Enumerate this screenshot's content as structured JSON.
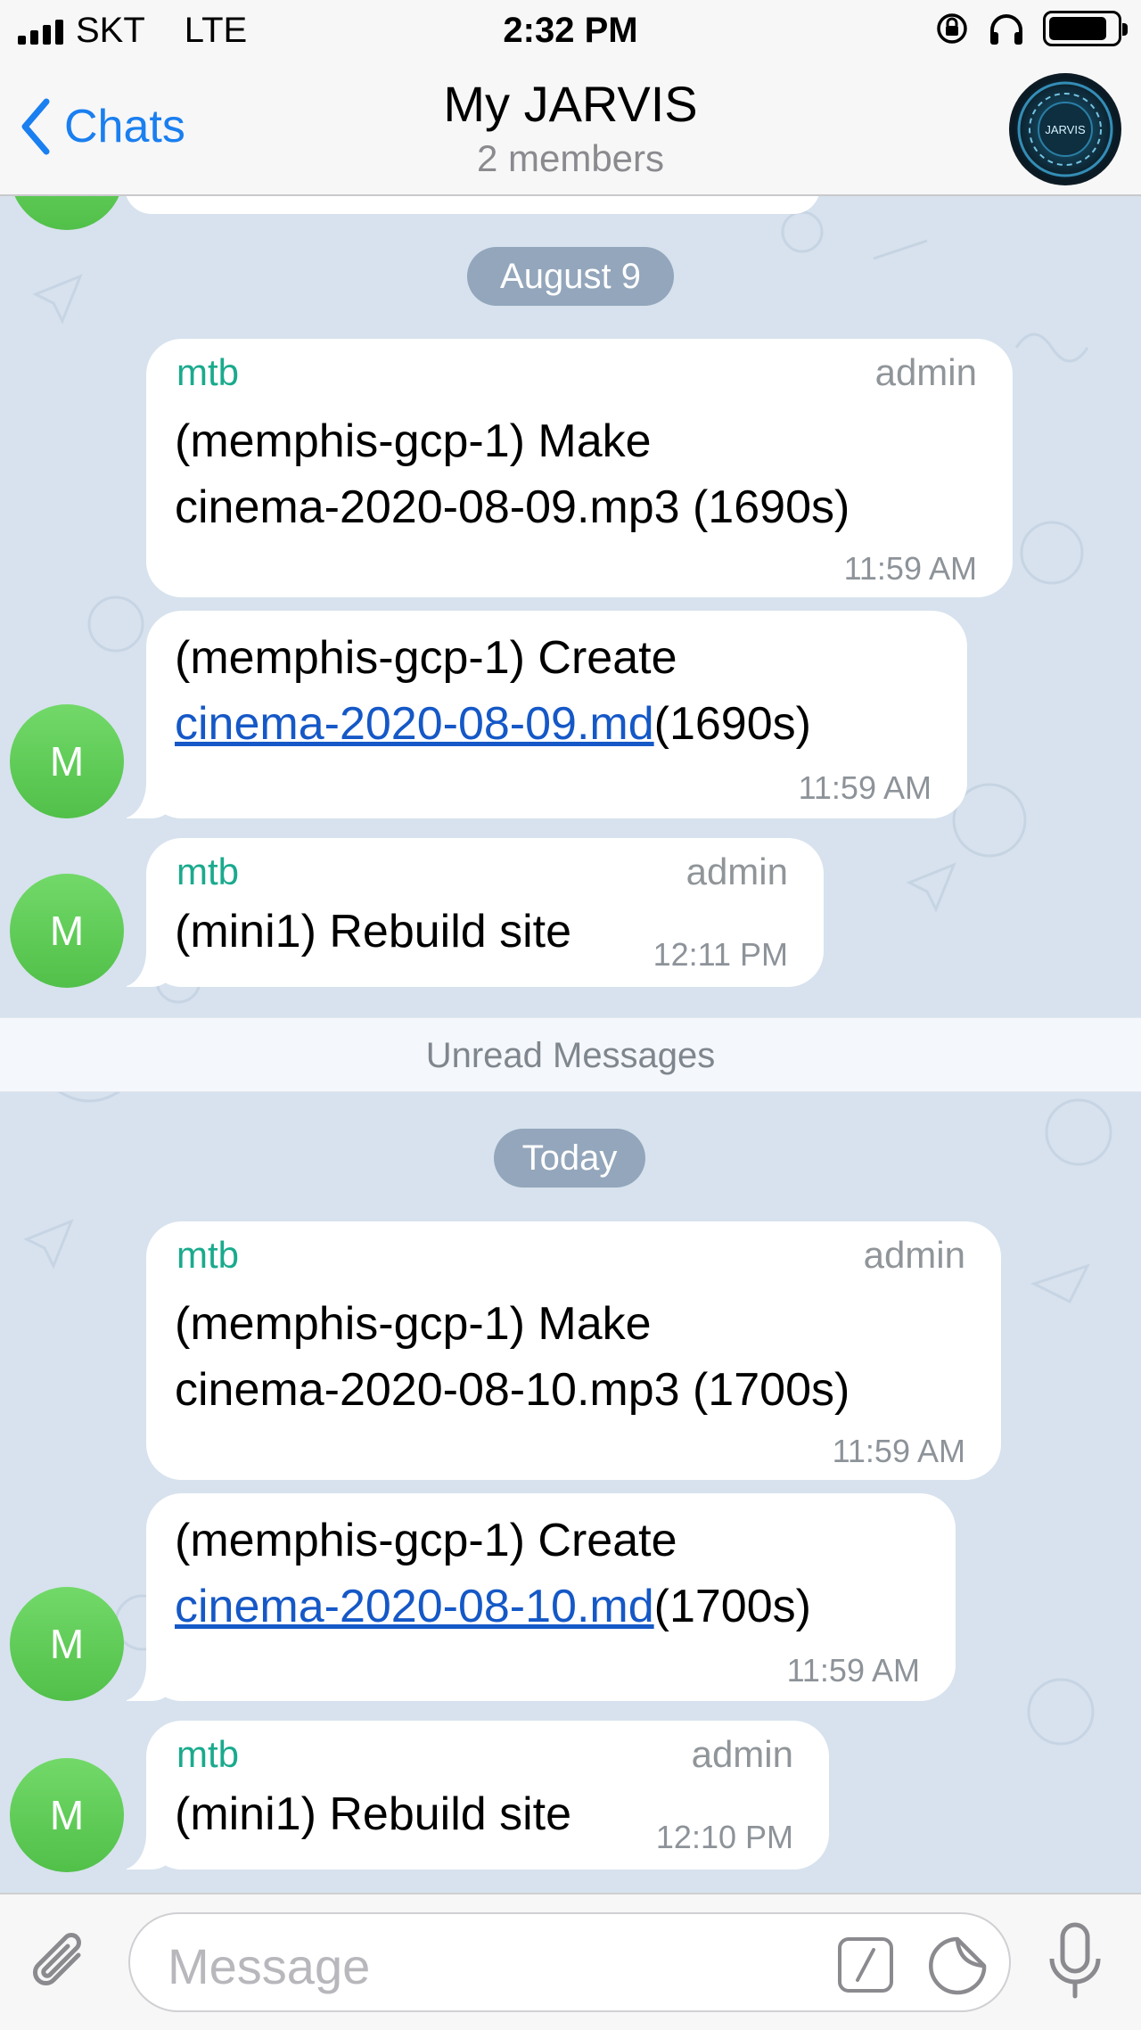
{
  "status_bar": {
    "carrier": "SKT",
    "network": "LTE",
    "time": "2:32 PM",
    "battery_level": 0.86
  },
  "header": {
    "back_label": "Chats",
    "title": "My JARVIS",
    "subtitle": "2 members",
    "avatar_text": "JARVIS"
  },
  "dates": {
    "first": "August 9",
    "second": "Today"
  },
  "unread_label": "Unread Messages",
  "messages": [
    {
      "sender": "mtb",
      "role": "admin",
      "line1": "(memphis-gcp-1) Make",
      "line2": "cinema-2020-08-09.mp3 (1690s)",
      "time": "11:59 AM"
    },
    {
      "line1": "(memphis-gcp-1) Create",
      "link": "cinema-2020-08-09.md",
      "suffix": "(1690s)",
      "time": "11:59 AM",
      "avatar": "M"
    },
    {
      "sender": "mtb",
      "role": "admin",
      "text": "(mini1) Rebuild site",
      "time": "12:11 PM",
      "avatar": "M"
    },
    {
      "sender": "mtb",
      "role": "admin",
      "line1": "(memphis-gcp-1) Make",
      "line2": "cinema-2020-08-10.mp3 (1700s)",
      "time": "11:59 AM"
    },
    {
      "line1": "(memphis-gcp-1) Create",
      "link": "cinema-2020-08-10.md",
      "suffix": "(1700s)",
      "time": "11:59 AM",
      "avatar": "M"
    },
    {
      "sender": "mtb",
      "role": "admin",
      "text": "(mini1) Rebuild site",
      "time": "12:10 PM",
      "avatar": "M"
    }
  ],
  "input": {
    "placeholder": "Message"
  },
  "colors": {
    "accent": "#1a7ff0",
    "sender": "#1aaa8d",
    "link": "#1558c7",
    "avatar_green": "#5ec756",
    "wallpaper": "#d7e2ee"
  },
  "icons": {
    "back": "chevron-left-icon",
    "attach": "paperclip-icon",
    "command": "slash-command-icon",
    "sticker": "sticker-icon",
    "mic": "microphone-icon"
  }
}
